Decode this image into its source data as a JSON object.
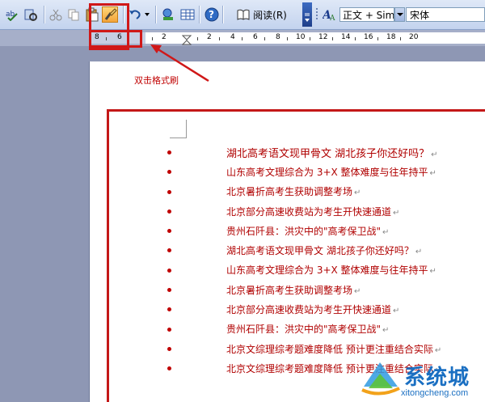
{
  "toolbar": {
    "read_label": "阅读(R)",
    "style_value": "正文 + Sim",
    "font_value": "宋体"
  },
  "ruler": {
    "ticks": [
      "8",
      "6",
      "2",
      "2",
      "4",
      "6",
      "8",
      "10",
      "12",
      "14",
      "16",
      "18",
      "20"
    ]
  },
  "annotation": {
    "label": "双击格式刷"
  },
  "document": {
    "items": [
      "湖北高考语文现甲骨文 湖北孩子你还好吗？",
      "山东高考文理综合为 3+X 整体难度与往年持平",
      "北京暑折高考生获助调整考场",
      "北京部分高速收费站为考生开快速通道",
      "贵州石阡县：洪灾中的\"高考保卫战\"",
      "湖北高考语文现甲骨文 湖北孩子你还好吗？",
      "山东高考文理综合为 3+X 整体难度与往年持平",
      "北京暑折高考生获助调整考场",
      "北京部分高速收费站为考生开快速通道",
      "贵州石阡县：洪灾中的\"高考保卫战\"",
      "北京文综理综考题难度降低 预计更注重结合实际",
      "北京文综理综考题难度降低 预计更注重结合实际"
    ],
    "para_mark": "↵"
  },
  "watermark": {
    "title": "系统城",
    "url": "xitongcheng.com"
  },
  "colors": {
    "accent_red": "#c41818",
    "text_red": "#b00000",
    "watermark_blue": "#1a6fc2"
  }
}
